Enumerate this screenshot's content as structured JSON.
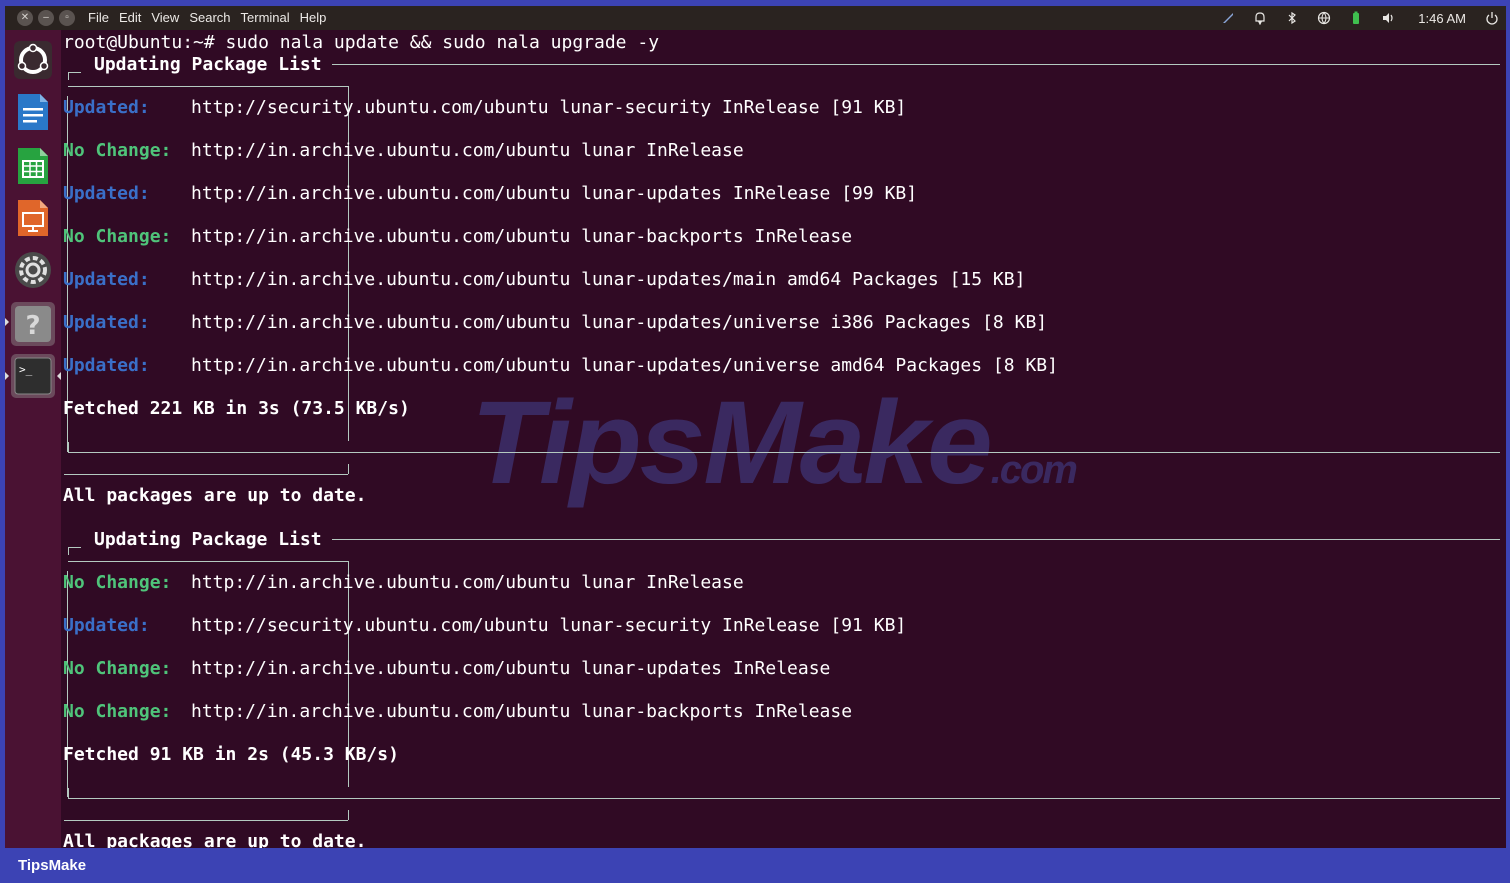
{
  "menu": [
    "File",
    "Edit",
    "View",
    "Search",
    "Terminal",
    "Help"
  ],
  "tray": {
    "icons": [
      "brush-icon",
      "bell-icon",
      "bluetooth-icon",
      "globe-icon",
      "battery-icon",
      "volume-icon",
      "power-icon"
    ],
    "clock": "1:46 AM"
  },
  "launcher": [
    "ubuntu-logo-icon",
    "writer-icon",
    "calc-icon",
    "impress-icon",
    "settings-icon",
    "help-icon",
    "terminal-icon"
  ],
  "terminal": {
    "prompt": "root@Ubuntu:~# sudo nala update && sudo nala upgrade -y",
    "section_title": "Updating Package List",
    "block1": [
      {
        "status": "Updated:",
        "kind": "updated",
        "url": "http://security.ubuntu.com/ubuntu lunar-security InRelease [91 KB]"
      },
      {
        "status": "No Change:",
        "kind": "nochange",
        "url": "http://in.archive.ubuntu.com/ubuntu lunar InRelease"
      },
      {
        "status": "Updated:",
        "kind": "updated",
        "url": "http://in.archive.ubuntu.com/ubuntu lunar-updates InRelease [99 KB]"
      },
      {
        "status": "No Change:",
        "kind": "nochange",
        "url": "http://in.archive.ubuntu.com/ubuntu lunar-backports InRelease"
      },
      {
        "status": "Updated:",
        "kind": "updated",
        "url": "http://in.archive.ubuntu.com/ubuntu lunar-updates/main amd64 Packages [15 KB]"
      },
      {
        "status": "Updated:",
        "kind": "updated",
        "url": "http://in.archive.ubuntu.com/ubuntu lunar-updates/universe i386 Packages [8 KB]"
      },
      {
        "status": "Updated:",
        "kind": "updated",
        "url": "http://in.archive.ubuntu.com/ubuntu lunar-updates/universe amd64 Packages [8 KB]"
      }
    ],
    "fetched1": "Fetched 221 KB in 3s (73.5 KB/s)",
    "uptodate": "All packages are up to date.",
    "block2": [
      {
        "status": "No Change:",
        "kind": "nochange",
        "url": "http://in.archive.ubuntu.com/ubuntu lunar InRelease"
      },
      {
        "status": "Updated:",
        "kind": "updated",
        "url": "http://security.ubuntu.com/ubuntu lunar-security InRelease [91 KB]"
      },
      {
        "status": "No Change:",
        "kind": "nochange",
        "url": "http://in.archive.ubuntu.com/ubuntu lunar-updates InRelease"
      },
      {
        "status": "No Change:",
        "kind": "nochange",
        "url": "http://in.archive.ubuntu.com/ubuntu lunar-backports InRelease"
      }
    ],
    "fetched2": "Fetched 91 KB in 2s (45.3 KB/s)",
    "uptodate2": "All packages are up to date."
  },
  "watermark": {
    "brand": "TipsMake",
    "suffix": ".com"
  },
  "footer": {
    "brand": "TipsMake"
  },
  "colors": {
    "terminal_bg": "#300a24",
    "updated": "#3a6fc8",
    "nochange": "#4fc47a",
    "frame": "#3c43b4"
  }
}
